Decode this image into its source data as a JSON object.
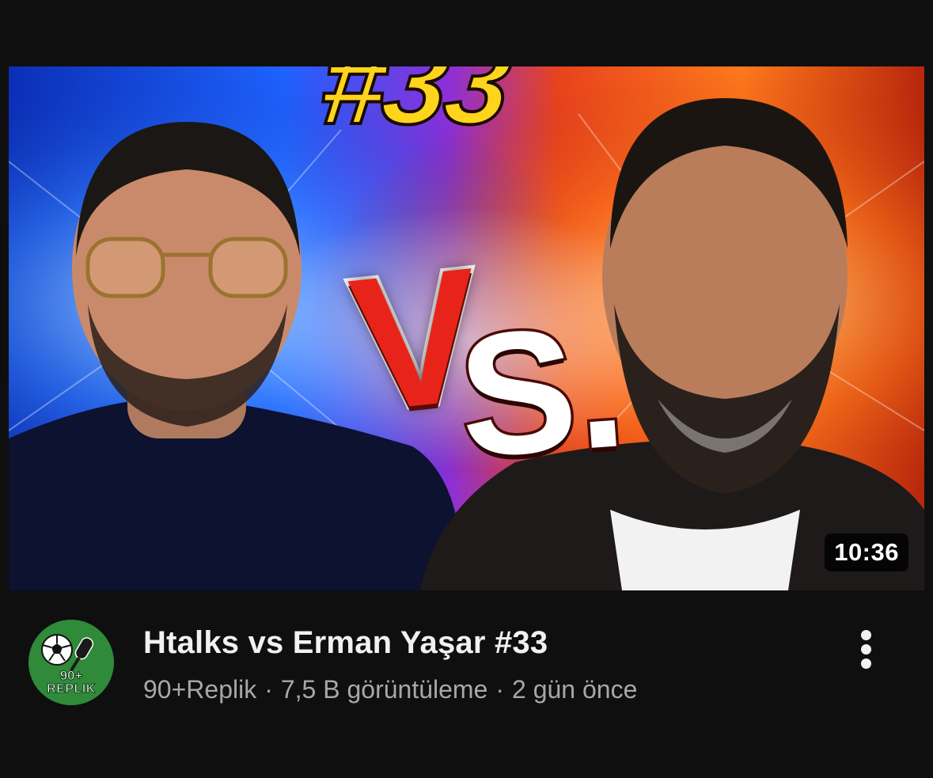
{
  "video": {
    "thumbnail": {
      "episode_text": "#33",
      "vs_v": "V",
      "vs_s": "S.",
      "duration": "10:36"
    },
    "channel": {
      "avatar_top_text": "90+",
      "avatar_bottom_text": "REPLIK",
      "name": "90+Replik"
    },
    "title": "Htalks vs Erman Yaşar #33",
    "views": "7,5 B görüntüleme",
    "age": "2 gün önce",
    "separator": "·",
    "more_icon": "more-vertical-icon"
  },
  "colors": {
    "background": "#0f0f0f",
    "title": "#f1f1f1",
    "meta": "#a8a8a8",
    "avatar_green": "#2f8a3a",
    "left_glow": "#2a6bff",
    "right_glow": "#ff5a12",
    "vs_red": "#e8231a",
    "episode_yellow": "#ffd41c"
  }
}
